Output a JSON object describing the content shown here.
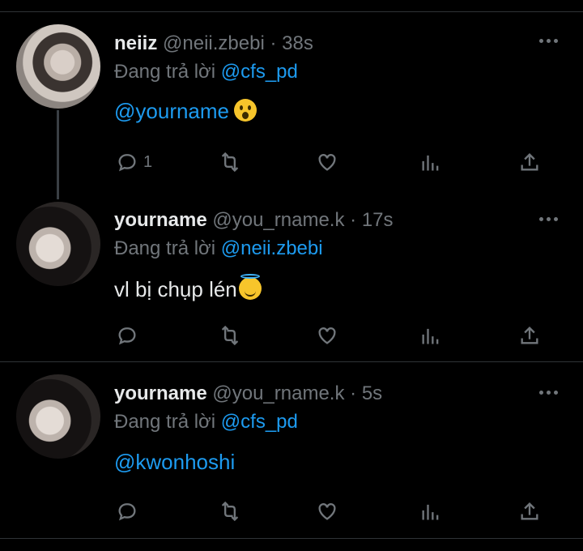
{
  "tweets": [
    {
      "name": "neiiz",
      "handle": "@neii.zbebi",
      "separator": "·",
      "time": "38s",
      "reply_prefix": "Đang trả lời",
      "reply_to": "@cfs_pd",
      "body_mention": "@yourname",
      "body_text": "",
      "emoji": "astonished-face-emoji",
      "reply_count": "1"
    },
    {
      "name": "yourname",
      "handle": "@you_rname.k",
      "separator": "·",
      "time": "17s",
      "reply_prefix": "Đang trả lời",
      "reply_to": "@neii.zbebi",
      "body_mention": "",
      "body_text": "vl bị chụp lén",
      "emoji": "smiling-face-with-halo-emoji",
      "reply_count": ""
    },
    {
      "name": "yourname",
      "handle": "@you_rname.k",
      "separator": "·",
      "time": "5s",
      "reply_prefix": "Đang trả lời",
      "reply_to": "@cfs_pd",
      "body_mention": "@kwonhoshi",
      "body_text": "",
      "emoji": "",
      "reply_count": ""
    }
  ],
  "colors": {
    "background": "#000000",
    "text": "#e7e9ea",
    "muted": "#71767b",
    "link": "#1d9bf0",
    "divider": "#2f3336"
  },
  "icons": [
    "reply-icon",
    "retweet-icon",
    "like-icon",
    "views-icon",
    "share-icon",
    "more-options-icon"
  ]
}
